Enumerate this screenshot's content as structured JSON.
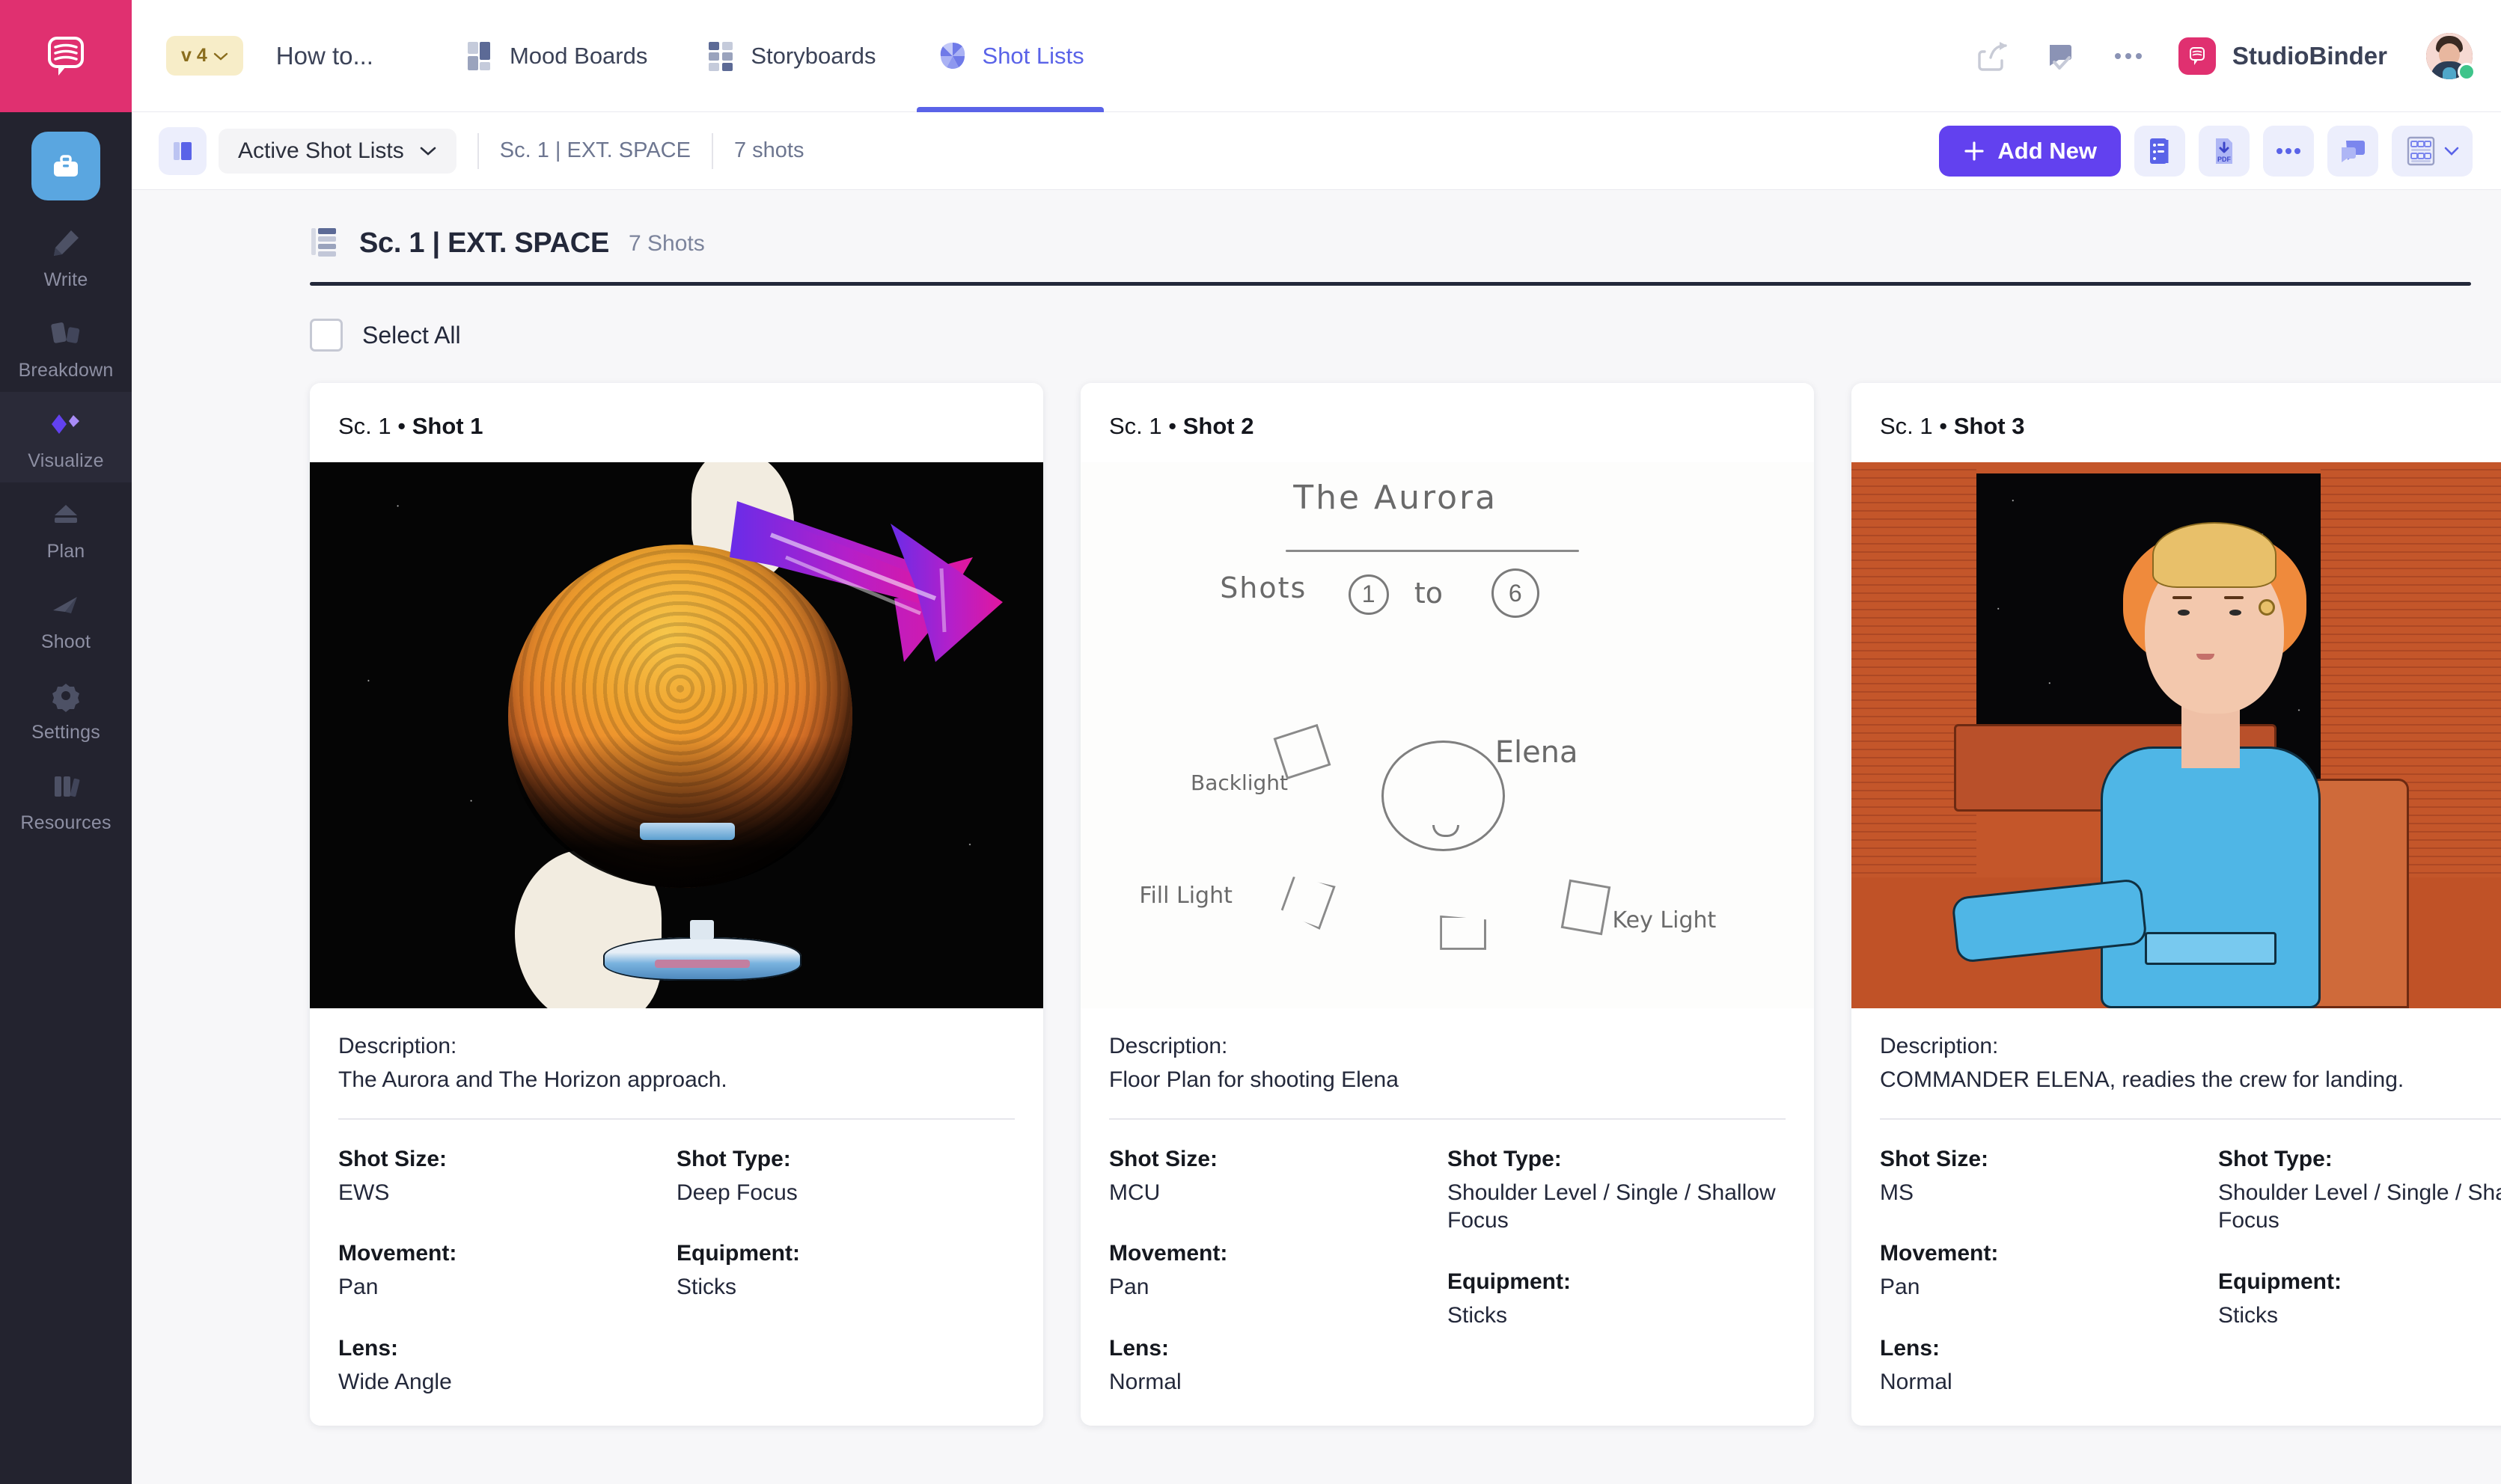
{
  "sidebar": {
    "logo_icon": "studiobinder-speech-bubble-logo",
    "home": {
      "icon": "briefcase-icon",
      "label": ""
    },
    "items": [
      {
        "label": "Write",
        "icon": "pencil-icon",
        "active": false
      },
      {
        "label": "Breakdown",
        "icon": "cards-icon",
        "active": false
      },
      {
        "label": "Visualize",
        "icon": "shapes-icon",
        "active": true
      },
      {
        "label": "Plan",
        "icon": "calendar-icon",
        "active": false
      },
      {
        "label": "Shoot",
        "icon": "paperplane-icon",
        "active": false
      },
      {
        "label": "Settings",
        "icon": "gear-icon",
        "active": false
      },
      {
        "label": "Resources",
        "icon": "books-icon",
        "active": false
      }
    ]
  },
  "topbar": {
    "version_chip": "v 4",
    "project_title": "How to...",
    "tabs": [
      {
        "label": "Mood Boards",
        "icon": "moodboard-icon",
        "active": false
      },
      {
        "label": "Storyboards",
        "icon": "storyboard-icon",
        "active": false
      },
      {
        "label": "Shot Lists",
        "icon": "aperture-icon",
        "active": true
      }
    ],
    "actions": [
      {
        "name": "share-icon",
        "glyph": "share"
      },
      {
        "name": "approve-icon",
        "glyph": "approve"
      },
      {
        "name": "more-icon",
        "glyph": "dots"
      }
    ],
    "brand": "StudioBinder",
    "avatar_status": "online"
  },
  "toolbar": {
    "panel_toggle_icon": "sidepanel-icon",
    "list_selector": "Active Shot Lists",
    "breadcrumb_scene": "Sc. 1 | EXT. SPACE",
    "breadcrumb_shots": "7 shots",
    "add_new_label": "Add New",
    "icons": [
      {
        "name": "list-view-icon"
      },
      {
        "name": "pdf-download-icon",
        "label": "PDF"
      },
      {
        "name": "more-options-icon"
      },
      {
        "name": "comment-icon"
      },
      {
        "name": "grid-layout-icon"
      }
    ]
  },
  "scene": {
    "icon": "scene-list-icon",
    "title": "Sc. 1 | EXT. SPACE",
    "shot_count": "7 Shots",
    "select_all_label": "Select All"
  },
  "labels": {
    "description": "Description:",
    "shot_size": "Shot Size:",
    "shot_type": "Shot Type:",
    "movement": "Movement:",
    "equipment": "Equipment:",
    "lens": "Lens:"
  },
  "shots": [
    {
      "scene_prefix": "Sc. 1 • ",
      "shot_label": "Shot  1",
      "artwork": "planet-mars-with-spaceships",
      "description": "The Aurora and The Horizon approach.",
      "shot_size": "EWS",
      "shot_type": "Deep Focus",
      "movement": "Pan",
      "equipment": "Sticks",
      "lens": "Wide Angle"
    },
    {
      "scene_prefix": "Sc. 1 • ",
      "shot_label": "Shot  2",
      "artwork": "whiteboard-floor-plan-sketch",
      "description": "Floor Plan for shooting Elena",
      "shot_size": "MCU",
      "shot_type": "Shoulder Level / Single / Shallow Focus",
      "movement": "Pan",
      "equipment": "Sticks",
      "lens": "Normal"
    },
    {
      "scene_prefix": "Sc. 1 • ",
      "shot_label": "Shot  3",
      "artwork": "commander-elena-cockpit",
      "description": "COMMANDER ELENA, readies the crew for landing.",
      "shot_size": "MS",
      "shot_type": "Shoulder Level / Single / Shallow Focus",
      "movement": "Pan",
      "equipment": "Sticks",
      "lens": "Normal"
    }
  ],
  "sketch": {
    "title": "The Aurora",
    "shots_line": "Shots",
    "shot_from": "1",
    "shot_to_word": "to",
    "shot_to": "6",
    "backlight": "Backlight",
    "subject": "Elena",
    "fill_light": "Fill Light",
    "key_light": "Key Light"
  },
  "annotation": {
    "type": "arrow",
    "color_start": "#6a2ce8",
    "color_end": "#e0179f"
  },
  "colors": {
    "brand_pink": "#e03070",
    "accent_purple": "#6241ef",
    "tab_active": "#5a63e8",
    "rail_bg": "#23232f",
    "page_bg": "#f7f7f9"
  }
}
